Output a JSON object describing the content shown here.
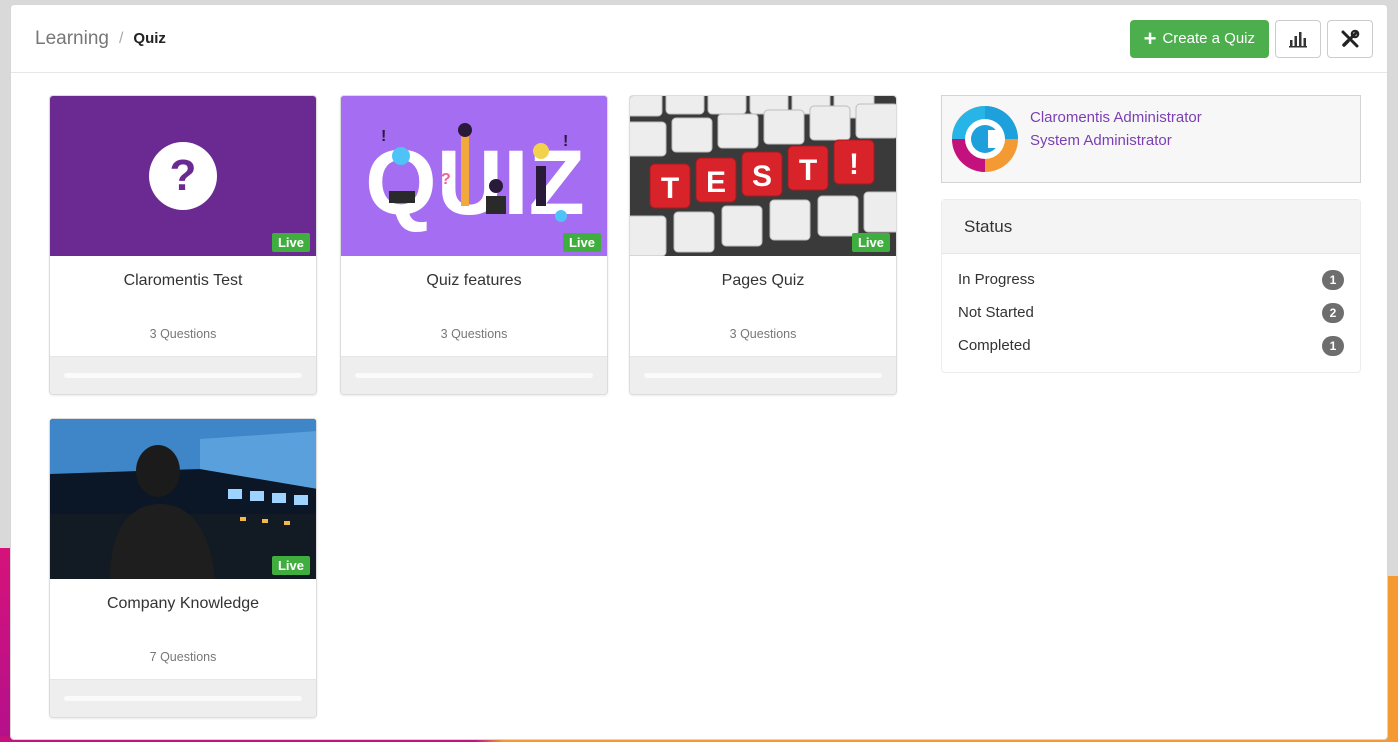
{
  "breadcrumb": {
    "root": "Learning",
    "separator": "/",
    "current": "Quiz"
  },
  "toolbar": {
    "create_label": "Create a Quiz",
    "create_icon": "plus-icon",
    "reports_icon": "bar-chart-icon",
    "settings_icon": "tools-icon"
  },
  "colors": {
    "primary_green": "#4cae4c",
    "accent_purple": "#7b3fb3",
    "badge_gray": "#6e6e6e"
  },
  "quizzes": [
    {
      "title": "Claromentis Test",
      "questions": "3 Questions",
      "status": "Live",
      "image": "question-mark-icon",
      "progress": 0
    },
    {
      "title": "Quiz features",
      "questions": "3 Questions",
      "status": "Live",
      "image": "quiz-illustration",
      "progress": 0
    },
    {
      "title": "Pages Quiz",
      "questions": "3 Questions",
      "status": "Live",
      "image": "keyboard-test-photo",
      "progress": 0
    },
    {
      "title": "Company Knowledge",
      "questions": "7 Questions",
      "status": "Live",
      "image": "cockpit-photo",
      "progress": 0
    }
  ],
  "profile": {
    "name": "Claromentis Administrator",
    "role": "System Administrator",
    "avatar": "claromentis-logo"
  },
  "status_panel": {
    "title": "Status",
    "rows": [
      {
        "label": "In Progress",
        "count": "1"
      },
      {
        "label": "Not Started",
        "count": "2"
      },
      {
        "label": "Completed",
        "count": "1"
      }
    ]
  }
}
